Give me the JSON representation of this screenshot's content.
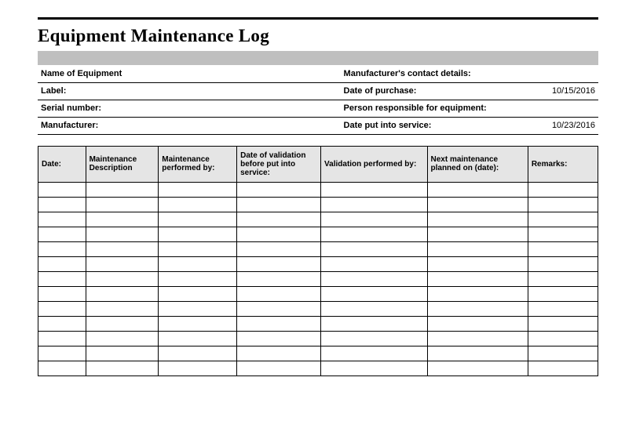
{
  "title": "Equipment Maintenance Log",
  "info": [
    {
      "label1": "Name of Equipment",
      "value1": "",
      "label2": "Manufacturer's contact details:",
      "value2": ""
    },
    {
      "label1": "Label:",
      "value1": "",
      "label2": "Date of purchase:",
      "value2": "10/15/2016"
    },
    {
      "label1": "Serial number:",
      "value1": "",
      "label2": "Person responsible for equipment:",
      "value2": ""
    },
    {
      "label1": "Manufacturer:",
      "value1": "",
      "label2": "Date put into service:",
      "value2": "10/23/2016"
    }
  ],
  "columns": [
    "Date:",
    "Maintenance Description",
    "Maintenance performed by:",
    "Date of validation before put into service:",
    "Validation performed by:",
    "Next maintenance planned on (date):",
    "Remarks:"
  ],
  "row_count": 13
}
